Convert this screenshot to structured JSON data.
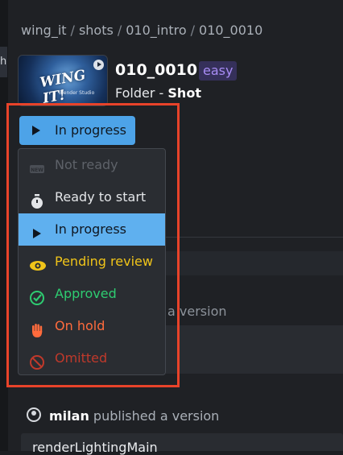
{
  "breadcrumb": {
    "parts": [
      "wing_it",
      "shots",
      "010_intro",
      "010_0010"
    ],
    "separator": "/"
  },
  "left_tab": {
    "label": "h"
  },
  "thumbnail": {
    "title_text": "WING IT!",
    "subtitle_text": "Blender Studio"
  },
  "shot": {
    "name": "010_0010",
    "difficulty": "easy",
    "type_prefix": "Folder -",
    "type_value": "Shot"
  },
  "status_button": {
    "label": "In progress"
  },
  "status_menu": {
    "options": [
      {
        "label": "Not ready",
        "icon": "new-badge-icon",
        "color": "#5e6269"
      },
      {
        "label": "Ready to start",
        "icon": "stopwatch-icon",
        "color": "#e3e5e8"
      },
      {
        "label": "In progress",
        "icon": "play-icon",
        "color": "#0f1620"
      },
      {
        "label": "Pending review",
        "icon": "eye-icon",
        "color": "#f0c419"
      },
      {
        "label": "Approved",
        "icon": "check-circle-icon",
        "color": "#2ecc71"
      },
      {
        "label": "On hold",
        "icon": "hand-icon",
        "color": "#ff6b3d"
      },
      {
        "label": "Omitted",
        "icon": "prohibited-icon",
        "color": "#c0392b"
      }
    ],
    "selected": "In progress"
  },
  "background": {
    "partial_text": "a version"
  },
  "activity": {
    "user": "milan",
    "action": "published a version",
    "icon": "user-circle-icon"
  },
  "version": {
    "name": "renderLightingMain"
  },
  "colors": {
    "accent": "#4da3e8",
    "highlight": "#e8432a",
    "difficulty": "#a88cf5"
  }
}
